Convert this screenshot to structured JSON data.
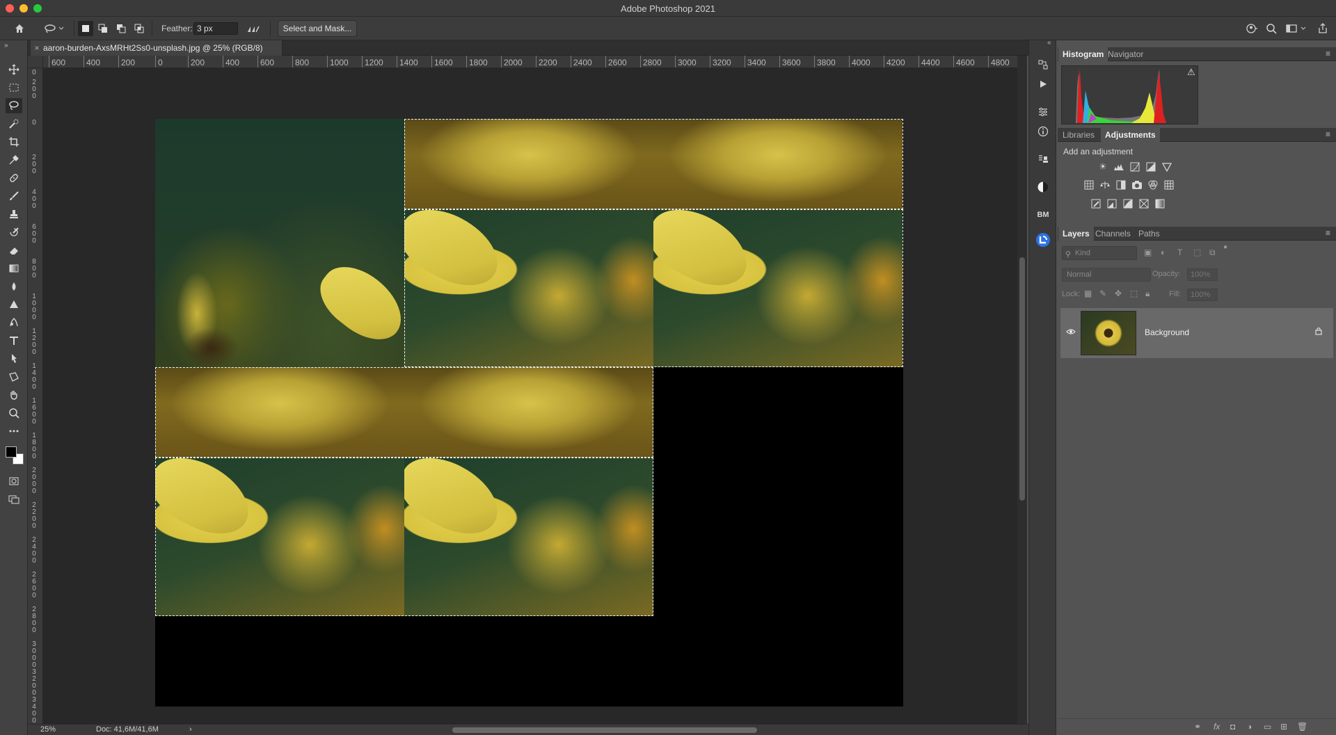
{
  "window": {
    "title": "Adobe Photoshop 2021"
  },
  "options_bar": {
    "feather_label": "Feather:",
    "feather_value": "3 px",
    "select_and_mask_label": "Select and Mask..."
  },
  "document_tab": {
    "close_glyph": "×",
    "title": "aaron-burden-AxsMRHt2Ss0-unsplash.jpg @ 25% (RGB/8)"
  },
  "ruler": {
    "horizontal_ticks": [
      "600",
      "400",
      "200",
      "0",
      "200",
      "400",
      "600",
      "800",
      "1000",
      "1200",
      "1400",
      "1600",
      "1800",
      "2000",
      "2200",
      "2400",
      "2600",
      "2800",
      "3000",
      "3200",
      "3400",
      "3600",
      "3800",
      "4000",
      "4200",
      "4400",
      "4600",
      "4800"
    ],
    "vertical_ticks": [
      "0",
      "200",
      "0",
      "200",
      "400",
      "600",
      "800",
      "1000",
      "1200",
      "1400",
      "1600",
      "1800",
      "2000",
      "2200",
      "2400",
      "2600",
      "2800",
      "3000",
      "3200",
      "3400"
    ]
  },
  "status_bar": {
    "zoom": "25%",
    "doc_size": "Doc: 41,6M/41,6M",
    "arrow": "›"
  },
  "panels": {
    "histogram_tabs": [
      "Histogram",
      "Navigator"
    ],
    "histogram_warning": "⚠",
    "adjustment_tabs": [
      "Libraries",
      "Adjustments"
    ],
    "add_adjustment": "Add an adjustment",
    "layer_tabs": [
      "Layers",
      "Channels",
      "Paths"
    ],
    "kind_placeholder": "Kind",
    "blend_mode": "Normal",
    "opacity_label": "Opacity:",
    "opacity_value": "100%",
    "lock_label": "Lock:",
    "fill_label": "Fill:",
    "fill_value": "100%",
    "layers": [
      {
        "name": "Background",
        "visible": true,
        "locked": true
      }
    ]
  },
  "dock": {
    "bm_label": "BM"
  },
  "icons": {
    "tools": [
      "move-icon",
      "marquee-icon",
      "lasso-icon",
      "quick-select-icon",
      "crop-icon",
      "eyedropper-icon",
      "spot-heal-icon",
      "brush-icon",
      "clone-stamp-icon",
      "history-brush-icon",
      "eraser-icon",
      "gradient-icon",
      "blur-icon",
      "dodge-icon",
      "pen-icon",
      "type-icon",
      "path-select-icon",
      "shape-icon",
      "hand-icon",
      "zoom-icon",
      "more-tools-icon"
    ]
  },
  "colors": {
    "accent": "#2c72e6",
    "foreground_color": "#000000",
    "background_color": "#ffffff"
  }
}
